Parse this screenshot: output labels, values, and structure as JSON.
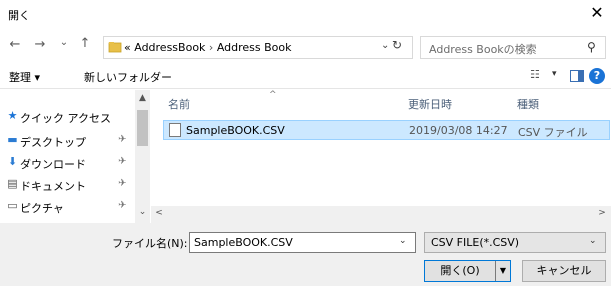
{
  "window": {
    "title": "開く",
    "close_glyph": "✕"
  },
  "nav": {
    "back": "←",
    "forward": "→",
    "history": "⌄",
    "up": "↑"
  },
  "address": {
    "prefix": "«",
    "segments": [
      "AddressBook",
      "Address Book"
    ],
    "separator": "›",
    "dropdown": "⌄",
    "refresh": "↻"
  },
  "search": {
    "placeholder": "Address Bookの検索",
    "icon": "⚲"
  },
  "toolbar": {
    "organize_label": "整理 ▾",
    "new_folder_label": "新しいフォルダー",
    "view_glyph": "☷",
    "view_dropdown": "▾",
    "help_glyph": "?"
  },
  "sidebar": {
    "items": [
      {
        "label": "クイック アクセス",
        "icon": "star-icon",
        "glyph": "★",
        "pinned": false
      },
      {
        "label": "デスクトップ",
        "icon": "desktop-icon",
        "glyph": "▬",
        "pinned": true
      },
      {
        "label": "ダウンロード",
        "icon": "download-icon",
        "glyph": "⬇",
        "pinned": true
      },
      {
        "label": "ドキュメント",
        "icon": "document-icon",
        "glyph": "▤",
        "pinned": true
      },
      {
        "label": "ピクチャ",
        "icon": "picture-icon",
        "glyph": "▭",
        "pinned": true
      }
    ],
    "pin_glyph": "✈"
  },
  "filelist": {
    "columns": [
      "名前",
      "更新日時",
      "種類"
    ],
    "sort_glyph": "^",
    "rows": [
      {
        "name": "SampleBOOK.CSV",
        "modified": "2019/03/08 14:27",
        "type": "CSV ファイル",
        "selected": true
      }
    ]
  },
  "scroll": {
    "up": "▲",
    "down": "⌄",
    "left": "<",
    "right": ">"
  },
  "footer": {
    "filename_label": "ファイル名(N):",
    "filename_value": "SampleBOOK.CSV",
    "filter_value": "CSV FILE(*.CSV)",
    "open_label": "開く(O)",
    "cancel_label": "キャンセル",
    "dropdown": "⌄",
    "split_arrow": "▼"
  },
  "colors": {
    "accent": "#0078d7",
    "selection": "#cce8ff",
    "help": "#1a73d6",
    "star": "#1a73d6"
  }
}
